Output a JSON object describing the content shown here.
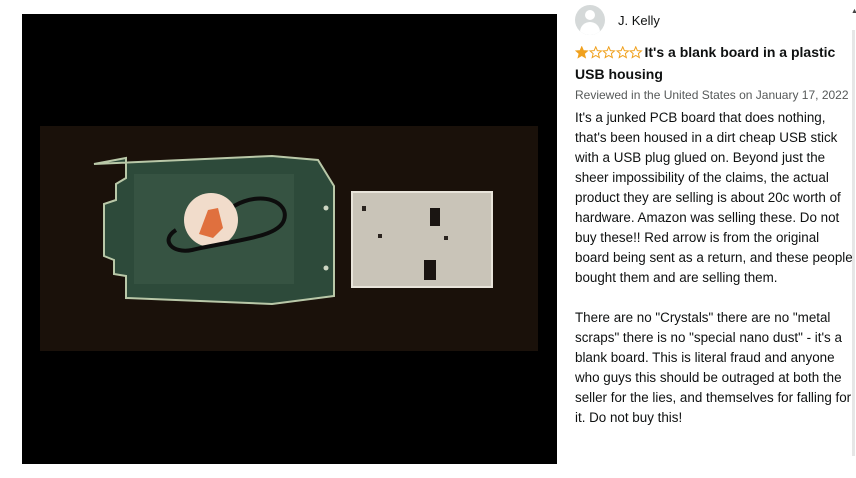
{
  "review": {
    "reviewer_name": "J. Kelly",
    "rating": 1,
    "rating_max": 5,
    "star_color": "#f0a11e",
    "title": "It's a blank board in a plastic USB housing",
    "date_line": "Reviewed in the United States on January 17, 2022",
    "body_p1": "It's a junked PCB board that does nothing, that's been housed in a dirt cheap USB stick with a USB plug glued on. Beyond just the sheer impossibility of the claims, the actual product they are selling is about 20c worth of hardware. Amazon was selling these. Do not buy these!! Red arrow is from the original board being sent as a return, and these people bought them and are selling them.",
    "body_p2": "There are no \"Crystals\" there are no \"metal scraps\" there is no \"special nano dust\" - it's a blank board. This is literal fraud and anyone who guys this should be outraged at both the seller for the lies, and themselves for falling for it. Do not buy this!"
  },
  "icons": {
    "avatar": "user-silhouette-icon",
    "star": "star-icon"
  }
}
